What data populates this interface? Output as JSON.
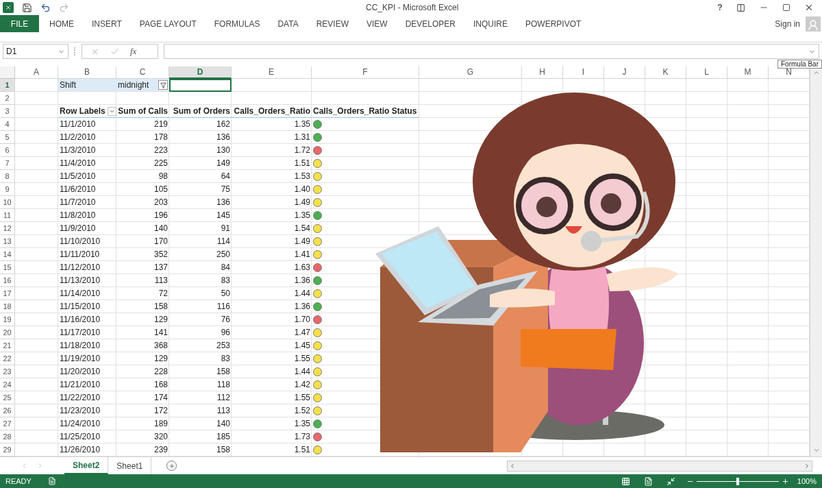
{
  "window": {
    "title": "CC_KPI - Microsoft Excel",
    "help": "?"
  },
  "ribbon": {
    "file_tab": "FILE",
    "tabs": [
      {
        "label": "HOME",
        "selected": false
      },
      {
        "label": "INSERT",
        "selected": false
      },
      {
        "label": "PAGE LAYOUT",
        "selected": false
      },
      {
        "label": "FORMULAS",
        "selected": false
      },
      {
        "label": "DATA",
        "selected": false
      },
      {
        "label": "REVIEW",
        "selected": false
      },
      {
        "label": "VIEW",
        "selected": false
      },
      {
        "label": "DEVELOPER",
        "selected": false
      },
      {
        "label": "INQUIRE",
        "selected": false
      },
      {
        "label": "POWERPIVOT",
        "selected": false
      }
    ],
    "sign_in": "Sign in"
  },
  "formula_bar": {
    "name_box": "D1",
    "fx": "fx",
    "tooltip": "Formula Bar"
  },
  "columns": [
    {
      "label": "A",
      "selected": false
    },
    {
      "label": "B",
      "selected": false
    },
    {
      "label": "C",
      "selected": false
    },
    {
      "label": "D",
      "selected": true
    },
    {
      "label": "E",
      "selected": false
    },
    {
      "label": "F",
      "selected": false
    },
    {
      "label": "G",
      "selected": false
    },
    {
      "label": "H",
      "selected": false
    },
    {
      "label": "I",
      "selected": false
    },
    {
      "label": "J",
      "selected": false
    },
    {
      "label": "K",
      "selected": false
    },
    {
      "label": "L",
      "selected": false
    },
    {
      "label": "M",
      "selected": false
    },
    {
      "label": "N",
      "selected": false
    }
  ],
  "row_numbers": [
    "1",
    "2",
    "3",
    "4",
    "5",
    "6",
    "7",
    "8",
    "9",
    "10",
    "11",
    "12",
    "13",
    "14",
    "15",
    "16",
    "17",
    "18",
    "19",
    "20",
    "21",
    "22",
    "23",
    "24",
    "25",
    "26",
    "27",
    "28",
    "29"
  ],
  "filter": {
    "label": "Shift",
    "value": "midnight"
  },
  "pivot_headers": [
    "Row Labels",
    "Sum of Calls",
    "Sum of Orders",
    "Calls_Orders_Ratio",
    "Calls_Orders_Ratio Status"
  ],
  "pivot_rows": [
    {
      "date": "11/1/2010",
      "calls": "219",
      "orders": "162",
      "ratio": "1.35",
      "color": "#4caf50"
    },
    {
      "date": "11/2/2010",
      "calls": "178",
      "orders": "136",
      "ratio": "1.31",
      "color": "#4caf50"
    },
    {
      "date": "11/3/2010",
      "calls": "223",
      "orders": "130",
      "ratio": "1.72",
      "color": "#e8676b"
    },
    {
      "date": "11/4/2010",
      "calls": "225",
      "orders": "149",
      "ratio": "1.51",
      "color": "#f4e04d"
    },
    {
      "date": "11/5/2010",
      "calls": "98",
      "orders": "64",
      "ratio": "1.53",
      "color": "#f4e04d"
    },
    {
      "date": "11/6/2010",
      "calls": "105",
      "orders": "75",
      "ratio": "1.40",
      "color": "#f4e04d"
    },
    {
      "date": "11/7/2010",
      "calls": "203",
      "orders": "136",
      "ratio": "1.49",
      "color": "#f4e04d"
    },
    {
      "date": "11/8/2010",
      "calls": "196",
      "orders": "145",
      "ratio": "1.35",
      "color": "#4caf50"
    },
    {
      "date": "11/9/2010",
      "calls": "140",
      "orders": "91",
      "ratio": "1.54",
      "color": "#f4e04d"
    },
    {
      "date": "11/10/2010",
      "calls": "170",
      "orders": "114",
      "ratio": "1.49",
      "color": "#f4e04d"
    },
    {
      "date": "11/11/2010",
      "calls": "352",
      "orders": "250",
      "ratio": "1.41",
      "color": "#f4e04d"
    },
    {
      "date": "11/12/2010",
      "calls": "137",
      "orders": "84",
      "ratio": "1.63",
      "color": "#e8676b"
    },
    {
      "date": "11/13/2010",
      "calls": "113",
      "orders": "83",
      "ratio": "1.36",
      "color": "#4caf50"
    },
    {
      "date": "11/14/2010",
      "calls": "72",
      "orders": "50",
      "ratio": "1.44",
      "color": "#f4e04d"
    },
    {
      "date": "11/15/2010",
      "calls": "158",
      "orders": "116",
      "ratio": "1.36",
      "color": "#4caf50"
    },
    {
      "date": "11/16/2010",
      "calls": "129",
      "orders": "76",
      "ratio": "1.70",
      "color": "#e8676b"
    },
    {
      "date": "11/17/2010",
      "calls": "141",
      "orders": "96",
      "ratio": "1.47",
      "color": "#f4e04d"
    },
    {
      "date": "11/18/2010",
      "calls": "368",
      "orders": "253",
      "ratio": "1.45",
      "color": "#f4e04d"
    },
    {
      "date": "11/19/2010",
      "calls": "129",
      "orders": "83",
      "ratio": "1.55",
      "color": "#f4e04d"
    },
    {
      "date": "11/20/2010",
      "calls": "228",
      "orders": "158",
      "ratio": "1.44",
      "color": "#f4e04d"
    },
    {
      "date": "11/21/2010",
      "calls": "168",
      "orders": "118",
      "ratio": "1.42",
      "color": "#f4e04d"
    },
    {
      "date": "11/22/2010",
      "calls": "174",
      "orders": "112",
      "ratio": "1.55",
      "color": "#f4e04d"
    },
    {
      "date": "11/23/2010",
      "calls": "172",
      "orders": "113",
      "ratio": "1.52",
      "color": "#f4e04d"
    },
    {
      "date": "11/24/2010",
      "calls": "189",
      "orders": "140",
      "ratio": "1.35",
      "color": "#4caf50"
    },
    {
      "date": "11/25/2010",
      "calls": "320",
      "orders": "185",
      "ratio": "1.73",
      "color": "#e8676b"
    },
    {
      "date": "11/26/2010",
      "calls": "239",
      "orders": "158",
      "ratio": "1.51",
      "color": "#f4e04d"
    }
  ],
  "sheet_tabs": [
    {
      "label": "Sheet2",
      "selected": true
    },
    {
      "label": "Sheet1",
      "selected": false
    }
  ],
  "status_bar": {
    "status": "READY",
    "zoom": "100%",
    "zoom_slider": {
      "level": 0.5
    }
  }
}
